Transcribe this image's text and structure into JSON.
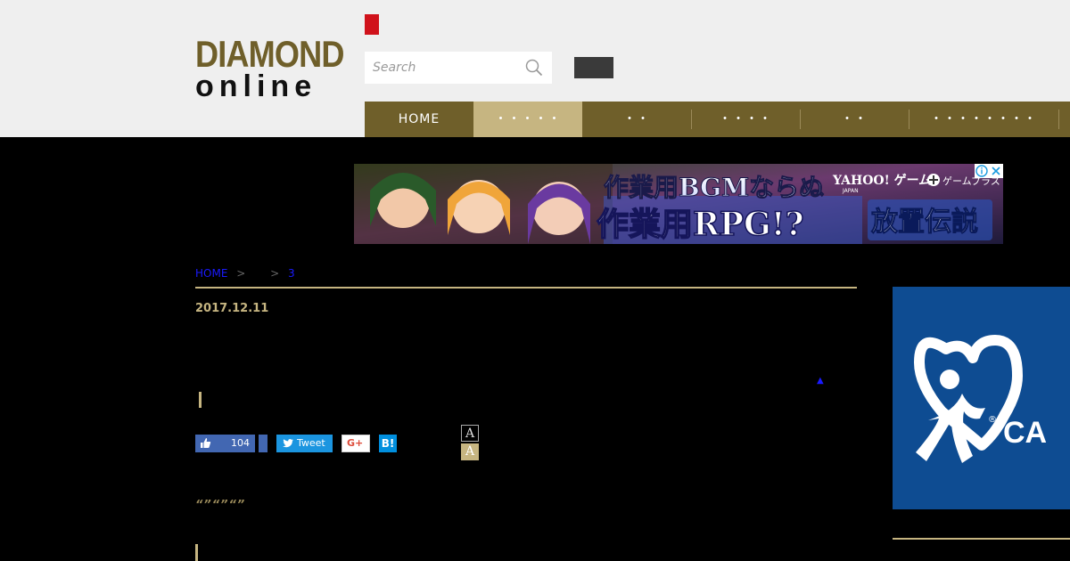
{
  "logo": {
    "line1": "DIAMOND",
    "line2": "online"
  },
  "search": {
    "placeholder": "Search"
  },
  "nav": {
    "items": [
      {
        "label": "HOME"
      },
      {
        "label": "・・・・・"
      },
      {
        "label": "・・"
      },
      {
        "label": "・・・・"
      },
      {
        "label": "・・"
      },
      {
        "label": "・・・・・・・・"
      }
    ],
    "active_index": 1
  },
  "ad": {
    "line1": "作業用BGMならぬ",
    "line2": "作業用RPG!?",
    "brand": "YAHOO! ゲーム",
    "brand_sub": "JAPAN",
    "partner": "ゲームプラス",
    "game_title": "放置伝説"
  },
  "breadcrumb": {
    "home": "HOME",
    "sep": ">",
    "page": "3"
  },
  "article": {
    "date": "2017.12.11",
    "quote": "“”“”“”"
  },
  "share": {
    "like_count": "104",
    "tweet_label": "Tweet",
    "gplus_label": "G+",
    "hatena_label": "B!"
  },
  "font_size": {
    "small": "A",
    "large": "A"
  },
  "side_ad": {
    "text": "CA"
  },
  "colors": {
    "gold": "#6f5f2a",
    "accent": "#c6b581",
    "red": "#d0121b",
    "link": "#1a1aff"
  }
}
